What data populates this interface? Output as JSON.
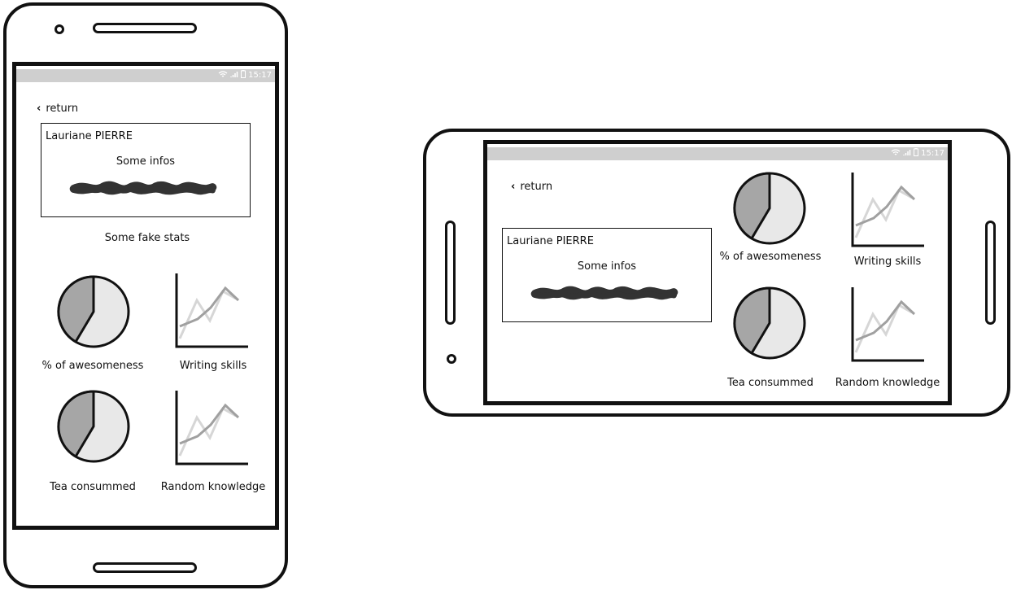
{
  "status": {
    "time": "15:17",
    "icons": [
      "wifi-icon",
      "signal-icon",
      "battery-icon"
    ]
  },
  "back_label": "return",
  "profile": {
    "name": "Lauriane PIERRE",
    "infos_label": "Some infos"
  },
  "section_title": "Some fake stats",
  "stats": [
    {
      "label": "% of awesomeness",
      "kind": "pie",
      "share": 0.42
    },
    {
      "label": "Writing skills",
      "kind": "line"
    },
    {
      "label": "Tea consummed",
      "kind": "pie",
      "share": 0.42
    },
    {
      "label": "Random knowledge",
      "kind": "line"
    }
  ],
  "colors": {
    "pie_dark": "#a6a6a6",
    "pie_light": "#e8e8e8",
    "line_dark": "#a0a0a0",
    "line_light": "#d6d6d6",
    "status_bar": "#cfcfcf"
  }
}
